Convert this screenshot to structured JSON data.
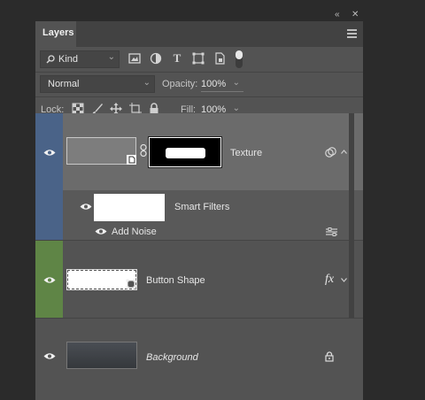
{
  "window_controls": {
    "collapse": "«",
    "close": "✕"
  },
  "panel": {
    "tab_label": "Layers"
  },
  "filter_bar": {
    "kind_label": "Kind"
  },
  "blend_bar": {
    "mode": "Normal",
    "opacity_label": "Opacity:",
    "opacity_value": "100%"
  },
  "lock_bar": {
    "lock_label": "Lock:",
    "fill_label": "Fill:",
    "fill_value": "100%"
  },
  "layers": {
    "texture": {
      "name": "Texture",
      "label_color": "#4a6388"
    },
    "smart_filters": {
      "label": "Smart Filters",
      "filter_name": "Add Noise"
    },
    "button_shape": {
      "name": "Button Shape",
      "fx_label": "fx",
      "label_color": "#5f8546"
    },
    "background": {
      "name": "Background"
    }
  },
  "colors": {
    "panel_bg": "#535353",
    "selected_layer_bg": "#6b6b6b",
    "app_bg": "#2b2b2b"
  }
}
